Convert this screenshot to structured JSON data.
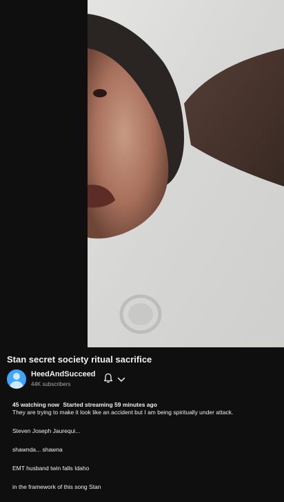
{
  "video": {
    "title": "Stan secret society ritual sacrifice"
  },
  "channel": {
    "name": "HeedAndSucceed",
    "subscribers": "44K subscribers",
    "avatar_icon": "person-avatar-icon"
  },
  "actions": {
    "bell_icon": "bell-icon",
    "chevron_icon": "chevron-down-icon"
  },
  "description": {
    "watching": "45 watching now",
    "started": "Started streaming 59 minutes ago",
    "lines": [
      "They are trying to make it look like an accident but I am being spiritually under attack.",
      "Steven Joseph Jaurequi...",
      "shawnda... shawna",
      "EMT husband twin falls Idaho",
      "in the framework of this song Stan"
    ]
  },
  "colors": {
    "background": "#0f0f0f",
    "text": "#f1f1f1",
    "secondary_text": "#aaaaaa",
    "avatar": "#3ea6ff"
  }
}
